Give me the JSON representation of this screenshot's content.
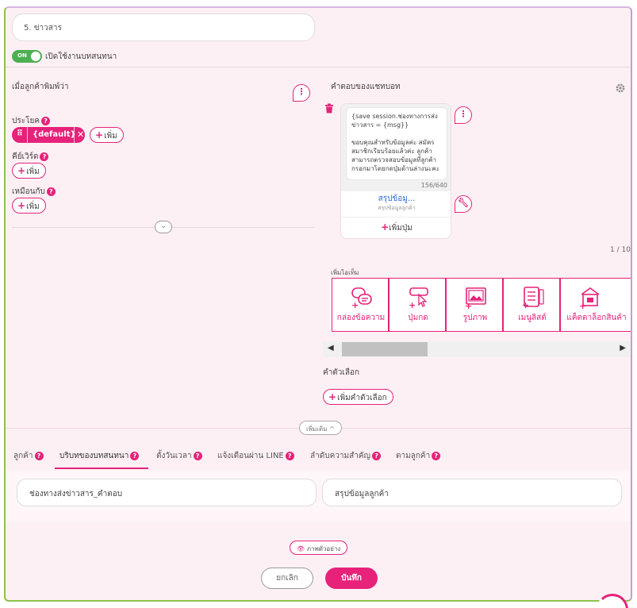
{
  "header": {
    "title_value": "5. ข่าวสาร",
    "toggle_state": "ON",
    "toggle_label": "เปิดใช้งานบทสนทนา"
  },
  "left": {
    "heading": "เมื่อลูกค้าพิมพ์ว่า",
    "sentence_label": "ประโยค",
    "default_chip": "{default}",
    "add_label": "เพิ่ม",
    "keyword_label": "คีย์เวิร์ด",
    "similar_label": "เหมือนกับ"
  },
  "right": {
    "heading": "คำตอบของแชทบอท",
    "message_text": "{save session.ช่องทางการส่งข่าวสาร = {msg}}\n\nขอบคุณสำหรับข้อมูลค่ะ สมัครสมาชิกเรียบร้อยแล้วค่ะ ลูกค้าสามารถตรวจสอบข้อมูลที่ลูกค้ากรอกมาโดยกดปุ่มด้านล่างนะคะ",
    "char_count": "156/640",
    "button_title": "สรุปข้อมู...",
    "button_subtitle": "สรุปข้อมูลลูกค้า",
    "add_button_label": "เพิ่มปุ่ม",
    "pagination": "1 / 10",
    "add_item_heading": "เพิ่มไอเท็ม",
    "tools": [
      {
        "label": "กล่องข้อความ",
        "icon": "chat-bubbles-icon"
      },
      {
        "label": "ปุ่มกด",
        "icon": "button-cursor-icon"
      },
      {
        "label": "รูปภาพ",
        "icon": "image-icon"
      },
      {
        "label": "เมนูลิสต์",
        "icon": "list-menu-icon"
      },
      {
        "label": "แค็ตตาล็อกสินค้า",
        "icon": "catalog-icon"
      }
    ],
    "quick_reply_heading": "คำตัวเลือก",
    "add_quick_reply": "เพิ่มคำตัวเลือก"
  },
  "more_label": "เพิ่มเติม ^",
  "tabs": [
    {
      "label": "ลูกค้า"
    },
    {
      "label": "บริบทของบทสนทนา"
    },
    {
      "label": "ตั้งวันเวลา"
    },
    {
      "label": "แจ้งเตือนผ่าน LINE"
    },
    {
      "label": "ลำดับความสำคัญ"
    },
    {
      "label": "ตามลูกค้า"
    }
  ],
  "context_fields": {
    "left_value": "ช่องทางส่งข่าวสาร_คำตอบ",
    "right_value": "สรุปข้อมูลลูกค้า"
  },
  "preview_label": "ภาพตัวอย่าง",
  "cancel_label": "ยกเลิก",
  "save_label": "บันทึก",
  "colors": {
    "accent": "#e6227a",
    "toggle_on": "#4caf50",
    "panel_bg": "#fdf0f4",
    "link": "#2b6bd6"
  }
}
